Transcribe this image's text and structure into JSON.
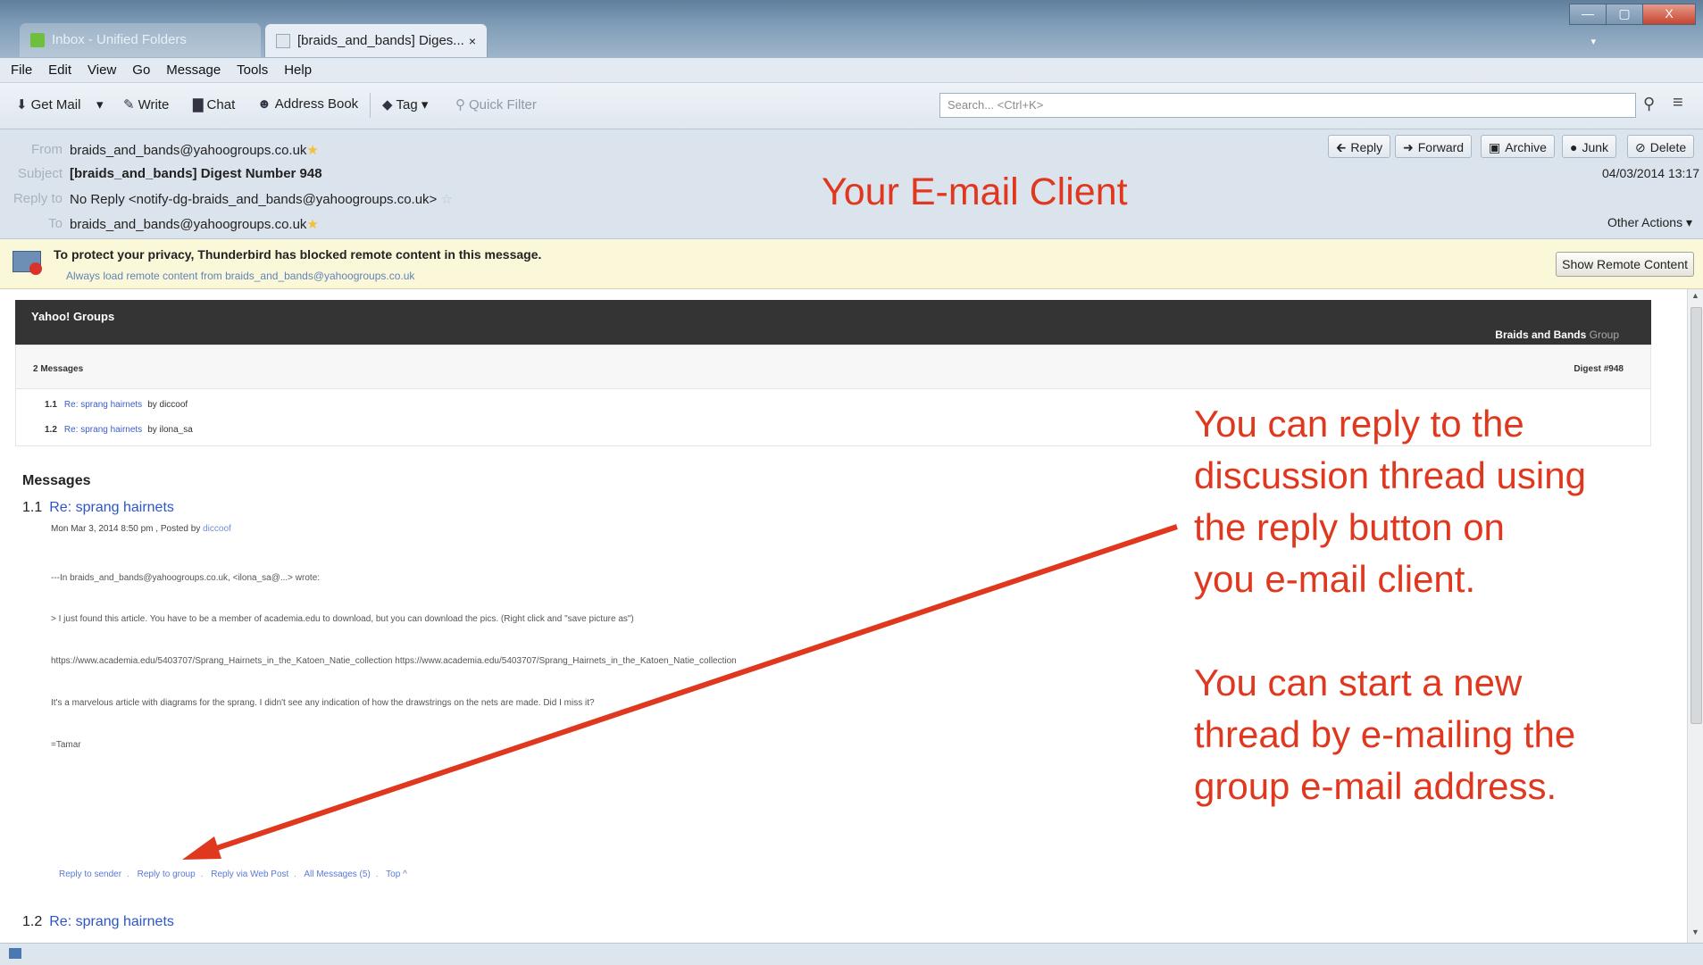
{
  "window": {
    "tabs": [
      {
        "label": "Inbox - Unified Folders"
      },
      {
        "label": "[braids_and_bands] Diges...",
        "close": "×"
      }
    ],
    "controls": {
      "minimize": "—",
      "maximize": "▢",
      "close": "X"
    }
  },
  "menubar": [
    "File",
    "Edit",
    "View",
    "Go",
    "Message",
    "Tools",
    "Help"
  ],
  "toolbar": {
    "get_mail": "Get Mail",
    "write": "Write",
    "chat": "Chat",
    "address_book": "Address Book",
    "tag": "Tag",
    "quick_filter": "Quick Filter",
    "search_placeholder": "Search... <Ctrl+K>"
  },
  "header": {
    "from_label": "From",
    "from_value": "braids_and_bands@yahoogroups.co.uk",
    "subject_label": "Subject",
    "subject_value": "[braids_and_bands] Digest Number 948",
    "replyto_label": "Reply to",
    "replyto_value": "No Reply <notify-dg-braids_and_bands@yahoogroups.co.uk>",
    "to_label": "To",
    "to_value": "braids_and_bands@yahoogroups.co.uk",
    "buttons": {
      "reply": "Reply",
      "forward": "Forward",
      "archive": "Archive",
      "junk": "Junk",
      "delete": "Delete"
    },
    "date": "04/03/2014 13:17",
    "other_actions": "Other Actions"
  },
  "notification": {
    "message": "To protect your privacy, Thunderbird has blocked remote content in this message.",
    "link": "Always load remote content from braids_and_bands@yahoogroups.co.uk",
    "button": "Show Remote Content"
  },
  "email": {
    "banner_left": "Yahoo! Groups",
    "banner_right_bold": "Braids and Bands",
    "banner_right_light": " Group",
    "message_count": "2 Messages",
    "digest_number": "Digest #948",
    "toc": [
      {
        "num": "1.1",
        "subject": "Re: sprang hairnets",
        "by": "by diccoof"
      },
      {
        "num": "1.2",
        "subject": "Re: sprang hairnets",
        "by": "by ilona_sa"
      }
    ],
    "messages_heading": "Messages",
    "msg1": {
      "num": "1.1",
      "subject": "Re: sprang hairnets",
      "meta_prefix": "Mon Mar 3, 2014 8:50 pm , Posted by",
      "meta_author": "diccoof",
      "lines": [
        "---In braids_and_bands@yahoogroups.co.uk, <ilona_sa@...> wrote:",
        "> I just found this article. You have to be a member of academia.edu to download, but you can download the pics. (Right click and \"save picture as\")",
        "https://www.academia.edu/5403707/Sprang_Hairnets_in_the_Katoen_Natie_collection https://www.academia.edu/5403707/Sprang_Hairnets_in_the_Katoen_Natie_collection",
        "It's a marvelous article with diagrams for the sprang. I didn't see any indication of how the drawstrings on the nets are made. Did I miss it?",
        "=Tamar"
      ],
      "links": [
        "Reply to sender",
        "Reply to group",
        "Reply via Web Post",
        "All Messages (5)",
        "Top ^"
      ]
    },
    "msg2": {
      "num": "1.2",
      "subject": "Re: sprang hairnets"
    }
  },
  "annotations": {
    "title": "Your E-mail Client",
    "reply_lines": [
      "You can reply to the",
      "discussion thread using",
      "the reply button on",
      "you e-mail client."
    ],
    "new_lines": [
      "You can start a new",
      "thread by e-mailing the",
      "group e-mail address."
    ],
    "color": "#e0381f"
  }
}
